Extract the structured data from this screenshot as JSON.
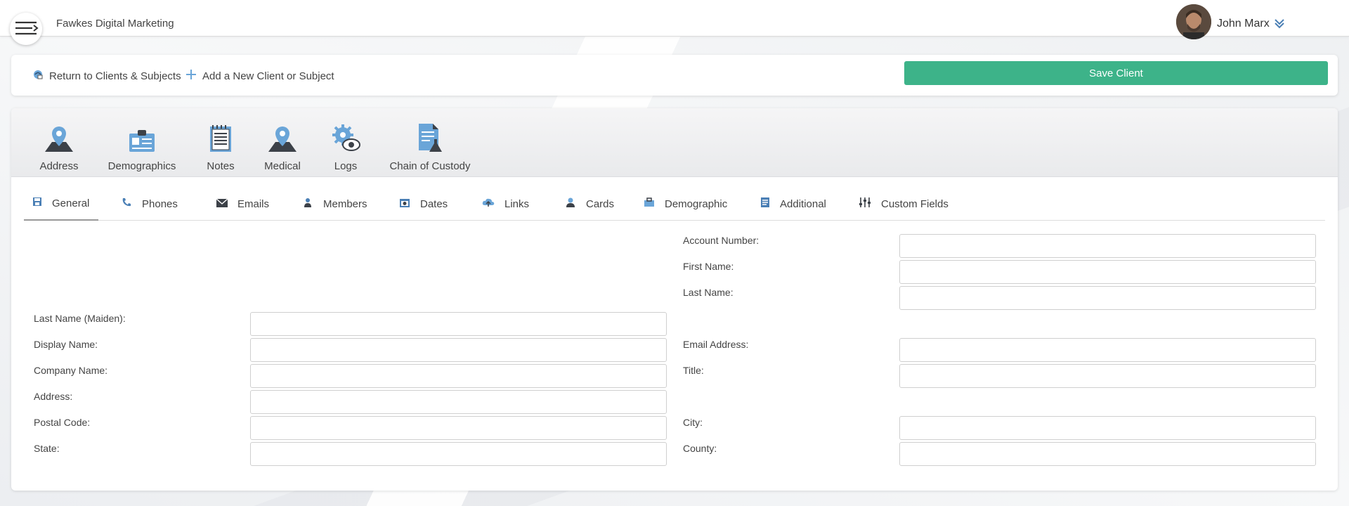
{
  "header": {
    "company": "Fawkes Digital Marketing",
    "user_name": "John Marx"
  },
  "actions": {
    "return_label": "Return to Clients & Subjects",
    "add_label": "Add a New Client or Subject",
    "save_label": "Save Client"
  },
  "modules": [
    {
      "label": "Address",
      "icon": "map-pin-icon"
    },
    {
      "label": "Demographics",
      "icon": "id-card-icon"
    },
    {
      "label": "Notes",
      "icon": "notepad-icon"
    },
    {
      "label": "Medical",
      "icon": "map-pin-icon"
    },
    {
      "label": "Logs",
      "icon": "gear-eye-icon"
    },
    {
      "label": "Chain of Custody",
      "icon": "document-flask-icon"
    }
  ],
  "tabs": [
    {
      "label": "General",
      "icon": "save-icon",
      "active": true
    },
    {
      "label": "Phones",
      "icon": "phone-icon"
    },
    {
      "label": "Emails",
      "icon": "envelope-icon"
    },
    {
      "label": "Members",
      "icon": "members-icon"
    },
    {
      "label": "Dates",
      "icon": "calendar-icon"
    },
    {
      "label": "Links",
      "icon": "cloud-icon"
    },
    {
      "label": "Cards",
      "icon": "user-card-icon"
    },
    {
      "label": "Demographic",
      "icon": "briefcase-icon"
    },
    {
      "label": "Additional",
      "icon": "list-icon"
    },
    {
      "label": "Custom Fields",
      "icon": "sliders-icon"
    }
  ],
  "form": {
    "account_number": {
      "label": "Account Number:",
      "value": ""
    },
    "first_name": {
      "label": "First Name:",
      "value": ""
    },
    "last_name": {
      "label": "Last Name:",
      "value": ""
    },
    "maiden_name": {
      "label": "Last Name (Maiden):",
      "value": ""
    },
    "display_name": {
      "label": "Display Name:",
      "value": ""
    },
    "email_address": {
      "label": "Email Address:",
      "value": ""
    },
    "company_name": {
      "label": "Company Name:",
      "value": ""
    },
    "title": {
      "label": "Title:",
      "value": ""
    },
    "address": {
      "label": "Address:",
      "value": ""
    },
    "postal_code": {
      "label": "Postal Code:",
      "value": ""
    },
    "city": {
      "label": "City:",
      "value": ""
    },
    "state": {
      "label": "State:",
      "value": ""
    },
    "county": {
      "label": "County:",
      "value": ""
    }
  },
  "colors": {
    "accent_green": "#3db389",
    "icon_blue": "#6aa5d8",
    "icon_dark": "#3c4148"
  }
}
